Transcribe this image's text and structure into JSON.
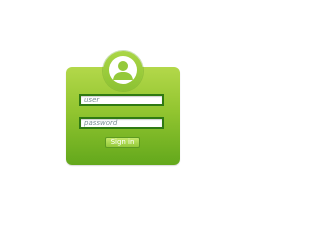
{
  "login_form": {
    "avatar_icon": "user-icon",
    "username_placeholder": "user",
    "password_placeholder": "password",
    "signin_label": "Sign in"
  },
  "colors": {
    "card_green": "#92c530",
    "field_border": "#2f7a12",
    "background": "#ffffff"
  }
}
